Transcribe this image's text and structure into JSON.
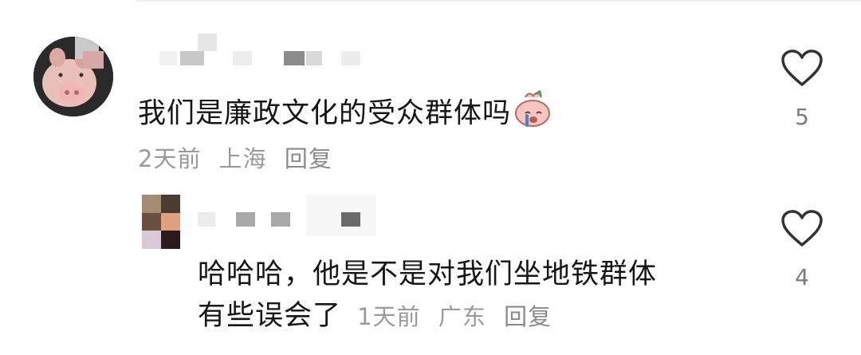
{
  "comments": [
    {
      "text": "我们是廉政文化的受众群体吗",
      "emoji": "crying-pig-emoji",
      "time": "2天前",
      "location": "上海",
      "reply_label": "回复",
      "likes": "5"
    },
    {
      "text_line1": "哈哈哈，他是不是对我们坐地铁群体",
      "text_line2": "有些误会了",
      "time": "1天前",
      "location": "广东",
      "reply_label": "回复",
      "likes": "4"
    }
  ],
  "icons": {
    "like": "heart-outline-icon",
    "avatar_main": "pig-avatar",
    "avatar_reply": "pixelated-avatar"
  },
  "colors": {
    "text": "#161616",
    "meta": "#9a9a9a",
    "heart_stroke": "#333333"
  }
}
